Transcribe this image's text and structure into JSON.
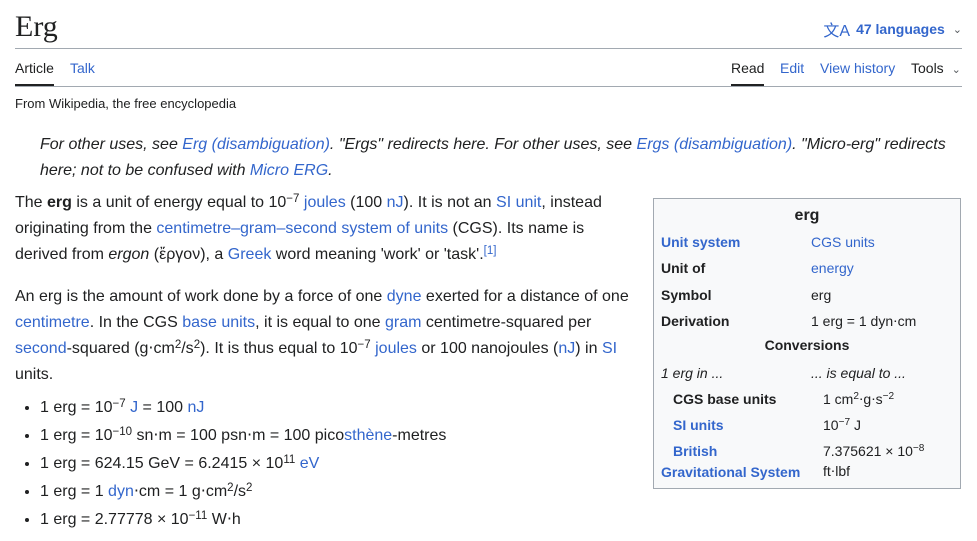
{
  "title": "Erg",
  "languages": "47 languages",
  "tabs": {
    "article": "Article",
    "talk": "Talk",
    "read": "Read",
    "edit": "Edit",
    "history": "View history",
    "tools": "Tools"
  },
  "tagline": "From Wikipedia, the free encyclopedia",
  "hatnote": {
    "t1": "For other uses, see ",
    "l1": "Erg (disambiguation)",
    "t2": ". \"Ergs\" redirects here. For other uses, see ",
    "l2": "Ergs (disambiguation)",
    "t3": ". \"Micro-erg\" redirects here; not to be confused with ",
    "l3": "Micro ERG",
    "t4": "."
  },
  "p1": {
    "a": "The ",
    "b": "erg",
    "c": " is a unit of energy equal to 10",
    "d": "−7",
    "e": "joules",
    "f": " (100 ",
    "g": "nJ",
    "h": "). It is not an ",
    "i": "SI unit",
    "j": ", instead originating from the ",
    "k": "centimetre–gram–second system of units",
    "l": " (CGS). Its name is derived from ",
    "m": "ergon",
    "n": " (ἔργον), a ",
    "o": "Greek",
    "p": " word meaning 'work' or 'task'.",
    "q": "[1]"
  },
  "p2": {
    "a": "An erg is the amount of work done by a force of one ",
    "b": "dyne",
    "c": " exerted for a distance of one ",
    "d": "centimetre",
    "e": ". In the CGS ",
    "f": "base units",
    "g": ", it is equal to one ",
    "h": "gram",
    "i": " centimetre-squared per ",
    "j": "second",
    "k": "-squared (g⋅cm",
    "l": "2",
    "m": "/s",
    "n": "2",
    "o": "). It is thus equal to 10",
    "p": "−7",
    "q": "joules",
    "r": " or 100 nanojoules (",
    "s": "nJ",
    "t": ") in ",
    "u": "SI",
    "v": " units."
  },
  "bullets": [
    {
      "a": "1 erg = 10",
      "b": "−7",
      "c": "J",
      "d": " = 100 ",
      "e": "nJ"
    },
    {
      "a": "1 erg = 10",
      "b": "−10",
      "c": " sn⋅m = 100 psn⋅m = 100 pico",
      "d": "sthène",
      "e": "-metres"
    },
    {
      "a": "1 erg = 624.15 GeV = 6.2415 × 10",
      "b": "11",
      "c": "eV"
    },
    {
      "a": "1 erg = 1 ",
      "b": "dyn",
      "c": "⋅cm = 1 g⋅cm",
      "d": "2",
      "e": "/s",
      "f": "2"
    },
    {
      "a": "1 erg = 2.77778 × 10",
      "b": "−11",
      "c": " W⋅h"
    }
  ],
  "infobox": {
    "title": "erg",
    "unit_system_k": "Unit system",
    "unit_system_v": "CGS units",
    "unit_of_k": "Unit of",
    "unit_of_v": "energy",
    "symbol_k": "Symbol",
    "symbol_v": "erg",
    "derivation_k": "Derivation",
    "derivation_v": "1 erg = 1 dyn⋅cm",
    "conversions": "Conversions",
    "erg_in": "1 erg in ...",
    "equal_to": "... is equal to ...",
    "cgs_k": "CGS base units",
    "cgs_v_a": "1 cm",
    "cgs_v_b": "2",
    "cgs_v_c": "⋅g⋅s",
    "cgs_v_d": "−2",
    "si_k": "SI units",
    "si_v_a": "10",
    "si_v_b": "−7",
    "si_v_c": " J",
    "brit_k1": "British",
    "brit_k2": "Gravitational System",
    "brit_v_a": "7.375621 × 10",
    "brit_v_b": "−8",
    "brit_v_c": " ft⋅lbf"
  }
}
